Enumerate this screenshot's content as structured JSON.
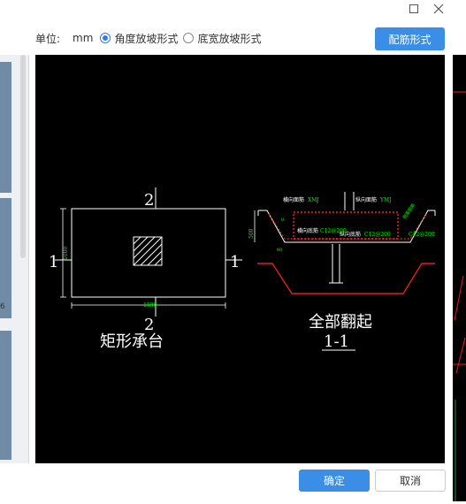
{
  "window": {
    "restore_icon": "restore-icon",
    "close_icon": "close-icon"
  },
  "options": {
    "unit_label": "单位:",
    "unit_value": "mm",
    "option_angle": "角度放坡形式",
    "option_width": "底宽放坡形式",
    "selected": "angle"
  },
  "toolbar": {
    "rebar_button": "配筋形式"
  },
  "footer": {
    "ok_button": "确定",
    "cancel_button": "取消"
  },
  "left_panel": {
    "snippet": "6"
  },
  "drawing": {
    "plan": {
      "section_mark_top": "2",
      "section_mark_bottom": "2",
      "section_mark_left": "1",
      "section_mark_right": "1",
      "width_dim": "1500",
      "height_dim": "1000",
      "caption": "矩形承台"
    },
    "section": {
      "label_top_horizontal": "横向面筋",
      "label_top_horizontal_code": "XMJ",
      "label_top_longitudinal": "纵向面筋",
      "label_top_longitudinal_code": "YMJ",
      "label_bottom_horizontal": "横向底筋",
      "label_bottom_horizontal_spec": "C12@200",
      "label_bottom_longitudinal": "纵向底筋",
      "label_bottom_longitudinal_spec": "C12@200",
      "right_spec": "C12@200",
      "side_note": "侧面钢筋",
      "height_dim": "500",
      "small_dim_a": "0",
      "small_dim_b": "60",
      "caption_main": "全部翻起",
      "caption_sub": "1-1"
    },
    "colors": {
      "line": "#ffffff",
      "rebar": "#ff2020",
      "dim": "#00ff00",
      "right_rebar": "#e02020"
    }
  }
}
